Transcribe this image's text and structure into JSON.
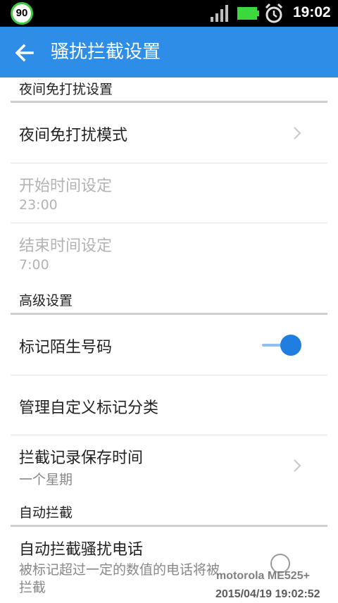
{
  "status_bar": {
    "badge": "90",
    "time": "19:02",
    "icons": [
      "signal-icon",
      "battery-icon",
      "alarm-clock-icon"
    ],
    "battery_color": "#3cd83c"
  },
  "app_bar": {
    "title": "骚扰拦截设置",
    "color": "#2e8de6",
    "back_icon": "arrow-left-icon"
  },
  "sections": {
    "night": {
      "header": "夜间免打扰设置",
      "mode": {
        "title": "夜间免打扰模式"
      },
      "start": {
        "title": "开始时间设定",
        "value": "23:00"
      },
      "end": {
        "title": "结束时间设定",
        "value": "7:00"
      }
    },
    "advanced": {
      "header": "高级设置",
      "mark_stranger": {
        "title": "标记陌生号码",
        "enabled": true
      },
      "manage_custom": {
        "title": "管理自定义标记分类"
      },
      "retention": {
        "title": "拦截记录保存时间",
        "value": "一个星期"
      }
    },
    "auto_block": {
      "header": "自动拦截",
      "auto_block_spam": {
        "title": "自动拦截骚扰电话",
        "description_line1": "被标记超过一定的数值的电话将被",
        "description_line2": "拦截",
        "enabled": false
      }
    }
  },
  "watermark": {
    "device": "motorola ME525+",
    "datetime": "2015/04/19 19:02:52"
  }
}
